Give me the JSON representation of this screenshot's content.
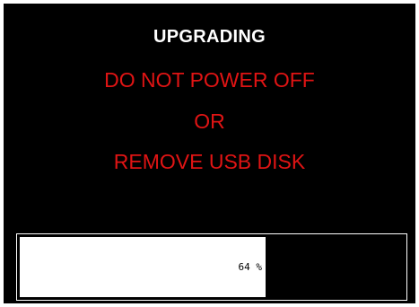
{
  "screen": {
    "title": "UPGRADING",
    "warning_line_1": "DO NOT POWER OFF",
    "warning_line_2": "OR",
    "warning_line_3": "REMOVE USB DISK"
  },
  "progress": {
    "percent": 64,
    "label": "64 %"
  },
  "colors": {
    "background": "#000000",
    "title": "#ffffff",
    "warning": "#e01414",
    "progress_fill": "#ffffff"
  }
}
